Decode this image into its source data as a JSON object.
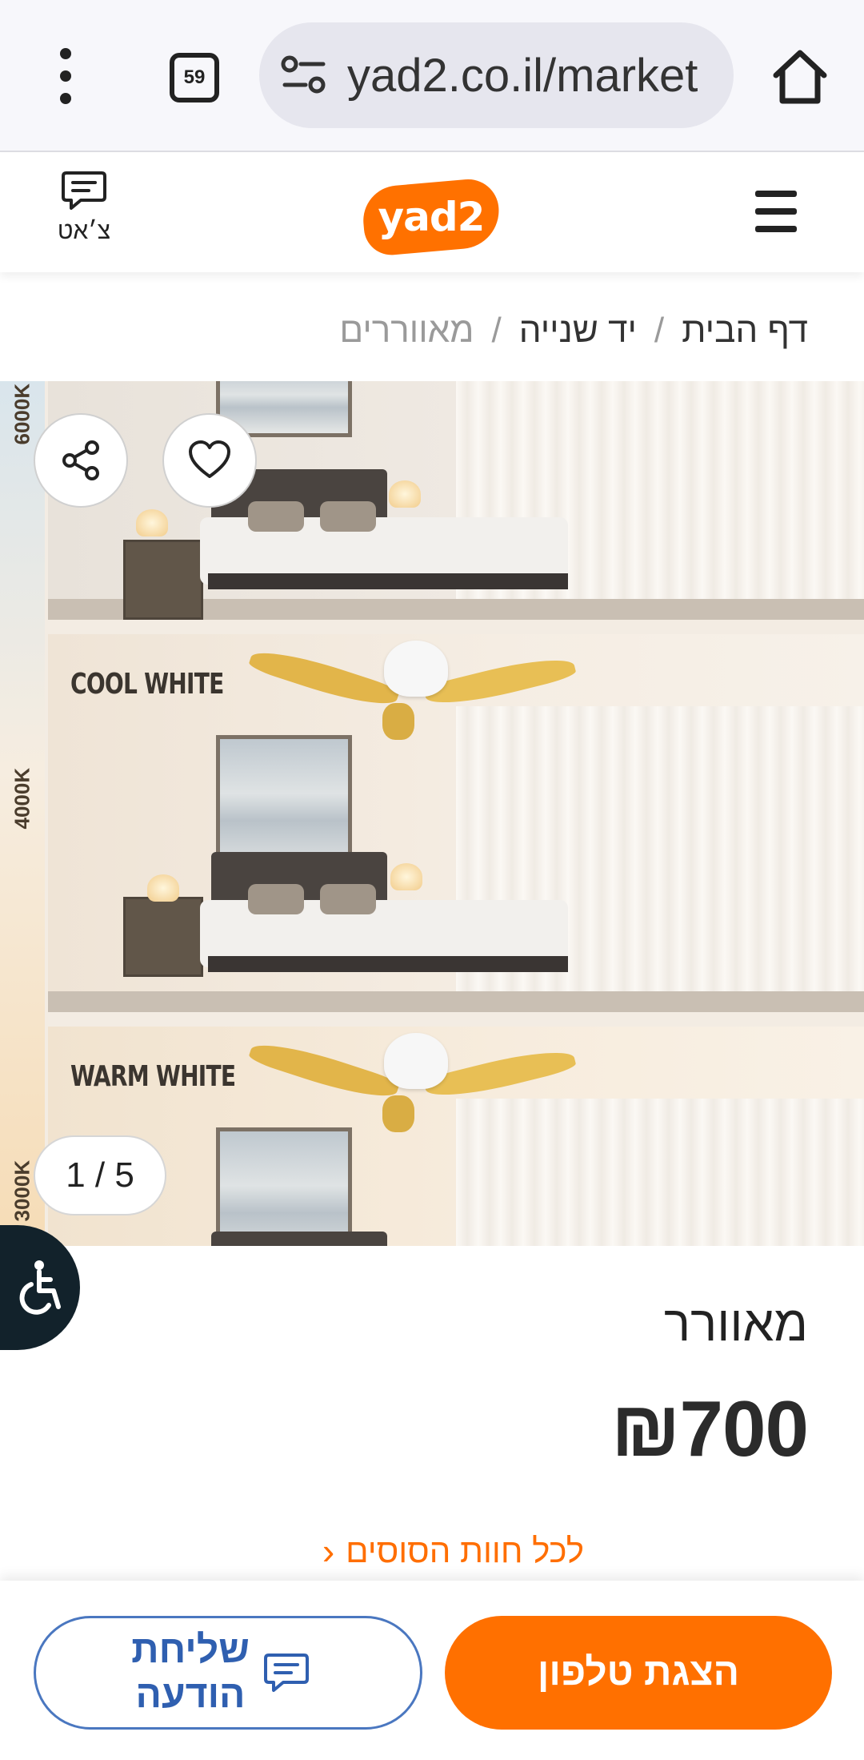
{
  "browser": {
    "url": "yad2.co.il/market",
    "tab_count": "59"
  },
  "header": {
    "chat_label": "צ׳אט",
    "logo_text": "yad2",
    "brand_color": "#ff7100"
  },
  "breadcrumb": {
    "items": [
      "דף הבית",
      "יד שנייה",
      "מאווררים"
    ],
    "separator": "/"
  },
  "gallery": {
    "counter": "1 / 5",
    "current_index": 1,
    "total": 5,
    "kelvin_labels": [
      "6000K",
      "4000K",
      "3000K"
    ],
    "panel_labels": [
      "COOL WHITE",
      "WARM WHITE"
    ]
  },
  "item": {
    "title": "מאוורר",
    "price": "₪700"
  },
  "category_link": {
    "label": "לכל חוות הסוסים"
  },
  "actions": {
    "send_message_label": "שליחת הודעה",
    "show_phone_label": "הצגת טלפון",
    "accent_color": "#ff7000",
    "message_color": "#2f5fb0"
  }
}
